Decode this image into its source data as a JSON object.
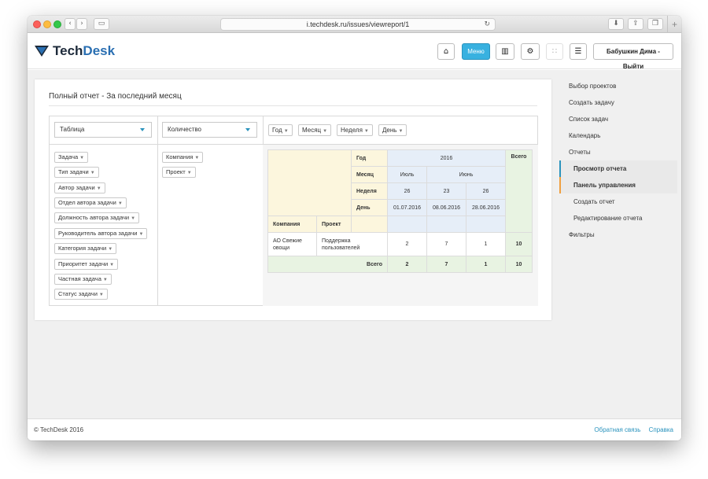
{
  "browser": {
    "url": "i.techdesk.ru/issues/viewreport/1",
    "reload_icon": "↻",
    "plus_label": "+"
  },
  "header": {
    "logo_tech": "Tech",
    "logo_desk": "Desk",
    "menu_label": "Меню",
    "user_label": "Бабушкин Дима - Выйти"
  },
  "report": {
    "title": "Полный отчет - За последний месяц",
    "view_select": "Таблица",
    "measure_select": "Количество",
    "time_filters": [
      "Год",
      "Месяц",
      "Неделя",
      "День"
    ],
    "row_fields": [
      "Задача",
      "Тип задачи",
      "Автор задачи",
      "Отдел автора задачи",
      "Должность автора задачи",
      "Руководитель автора задачи",
      "Категория задачи",
      "Приоритет задачи",
      "Частная задача",
      "Статус задачи"
    ],
    "col_fields": [
      "Компания",
      "Проект"
    ]
  },
  "table": {
    "h_year": "Год",
    "h_month": "Месяц",
    "h_week": "Неделя",
    "h_day": "День",
    "h_company": "Компания",
    "h_project": "Проект",
    "h_total": "Всего",
    "year": "2016",
    "month1": "Июль",
    "month2": "Июнь",
    "weeks": [
      "26",
      "23",
      "26"
    ],
    "days": [
      "01.07.2016",
      "08.06.2016",
      "28.06.2016"
    ],
    "row_company": "АО Свежие овощи",
    "row_project": "Поддержка пользователей",
    "row_values": [
      "2",
      "7",
      "1"
    ],
    "row_total": "10",
    "footer_label": "Всего",
    "footer_values": [
      "2",
      "7",
      "1"
    ],
    "footer_total": "10"
  },
  "sidebar": {
    "items": [
      "Выбор проектов",
      "Создать задачу",
      "Список задач",
      "Календарь",
      "Отчеты"
    ],
    "sub_items": [
      "Просмотр отчета",
      "Панель управления",
      "Создать отчет",
      "Редактирование отчета"
    ],
    "last_item": "Фильтры"
  },
  "footer": {
    "copyright": "© TechDesk 2016",
    "feedback": "Обратная связь",
    "help": "Справка"
  }
}
